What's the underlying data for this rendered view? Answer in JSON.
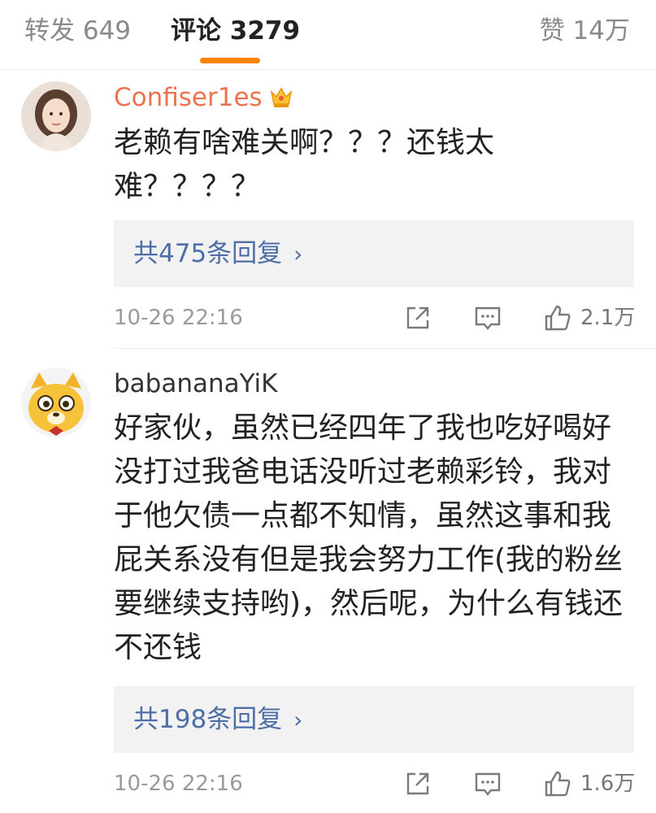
{
  "tabs": {
    "repost": {
      "label": "转发",
      "count": "649"
    },
    "comment": {
      "label": "评论",
      "count": "3279"
    },
    "like": {
      "label": "赞",
      "count": "14万"
    }
  },
  "colors": {
    "accent": "#ff8200",
    "vip_name": "#eb7350",
    "reply_link": "#4d6ea6",
    "muted": "#9a9a9a"
  },
  "comments": [
    {
      "username": "Confiser1es",
      "vip": true,
      "badge_icon": "crown-badge-icon",
      "text": "老赖有啥难关啊？？？还钱太难？？？？",
      "replies": {
        "prefix": "共",
        "count": "475",
        "suffix": "条回复"
      },
      "timestamp": "10-26 22:16",
      "likes": "2.1万",
      "icons": [
        "share-icon",
        "comment-icon",
        "like-icon"
      ]
    },
    {
      "username": "babananaYiK",
      "vip": false,
      "text": "好家伙，虽然已经四年了我也吃好喝好没打过我爸电话没听过老赖彩铃，我对于他欠债一点都不知情，虽然这事和我屁关系没有但是我会努力工作(我的粉丝要继续支持哟)，然后呢，为什么有钱还不还钱",
      "replies": {
        "prefix": "共",
        "count": "198",
        "suffix": "条回复"
      },
      "timestamp": "10-26 22:16",
      "likes": "1.6万",
      "icons": [
        "share-icon",
        "comment-icon",
        "like-icon"
      ]
    }
  ]
}
